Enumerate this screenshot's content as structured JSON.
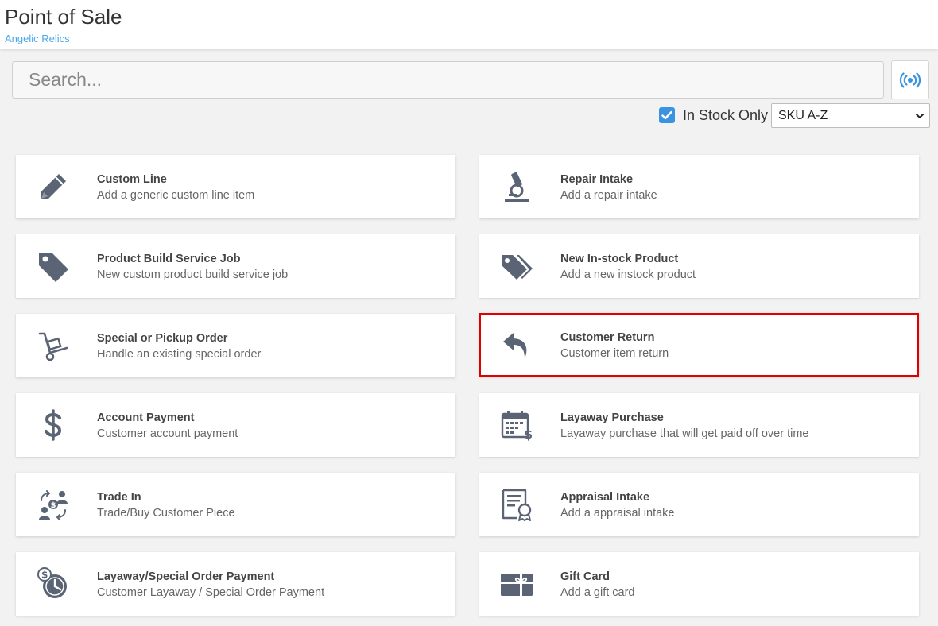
{
  "header": {
    "title": "Point of Sale",
    "store_name": "Angelic Relics"
  },
  "search": {
    "placeholder": "Search...",
    "value": ""
  },
  "filters": {
    "in_stock_label": "In Stock Only",
    "in_stock_checked": true,
    "sort_selected": "SKU A-Z"
  },
  "tiles": [
    {
      "title": "Custom Line",
      "description": "Add a generic custom line item",
      "icon": "pencil-icon"
    },
    {
      "title": "Repair Intake",
      "description": "Add a repair intake",
      "icon": "microscope-icon"
    },
    {
      "title": "Product Build Service Job",
      "description": "New custom product build service job",
      "icon": "tag-icon"
    },
    {
      "title": "New In-stock Product",
      "description": "Add a new instock product",
      "icon": "tags-icon"
    },
    {
      "title": "Special or Pickup Order",
      "description": "Handle an existing special order",
      "icon": "hand-truck-icon"
    },
    {
      "title": "Customer Return",
      "description": "Customer item return",
      "icon": "return-arrow-icon",
      "highlighted": true
    },
    {
      "title": "Account Payment",
      "description": "Customer account payment",
      "icon": "dollar-sign-icon"
    },
    {
      "title": "Layaway Purchase",
      "description": "Layaway purchase that will get paid off over time",
      "icon": "calendar-dollar-icon"
    },
    {
      "title": "Trade In",
      "description": "Trade/Buy Customer Piece",
      "icon": "trade-exchange-icon"
    },
    {
      "title": "Appraisal Intake",
      "description": "Add a appraisal intake",
      "icon": "certificate-icon"
    },
    {
      "title": "Layaway/Special Order Payment",
      "description": "Customer Layaway / Special Order Payment",
      "icon": "dollar-clock-icon"
    },
    {
      "title": "Gift Card",
      "description": "Add a gift card",
      "icon": "gift-card-icon"
    }
  ],
  "colors": {
    "accent": "#3a93e0",
    "link": "#4aa8e8",
    "icon": "#5a6475",
    "highlight": "#e00000"
  }
}
